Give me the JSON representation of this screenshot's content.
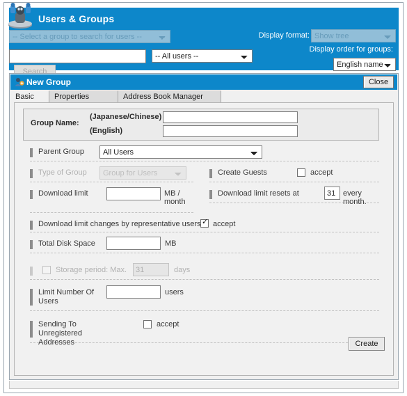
{
  "app": {
    "title": "Users & Groups",
    "icon": "users-group-icon",
    "accent_color": "#0d87ca"
  },
  "search_bar": {
    "group_select": {
      "value": "-- Select a group to search for users --",
      "disabled": true
    },
    "query_input": {
      "value": "",
      "placeholder": ""
    },
    "user_scope_select": {
      "value": "-- All users --",
      "disabled": false
    },
    "search_button": {
      "label": "Search",
      "disabled": true
    },
    "display_format": {
      "label": "Display format:",
      "value": "Show tree",
      "disabled": true
    },
    "display_order": {
      "label": "Display order for groups:",
      "value": "English names",
      "disabled": false
    }
  },
  "dialog": {
    "title": "New Group",
    "icon": "new-group-icon",
    "close_label": "Close",
    "tabs": [
      {
        "label": "Basic",
        "active": true
      },
      {
        "label": "Properties",
        "active": false
      },
      {
        "label": "Address Book Manager",
        "active": false
      }
    ],
    "group_name": {
      "label": "Group Name:",
      "japanese_chinese_label": "(Japanese/Chinese)",
      "japanese_chinese_value": "",
      "english_label": "(English)",
      "english_value": ""
    },
    "fields": {
      "parent_group": {
        "label": "Parent Group",
        "value": "All Users",
        "disabled": false
      },
      "type_of_group": {
        "label": "Type of Group",
        "value": "Group for Users",
        "disabled": true
      },
      "create_guests": {
        "label": "Create Guests",
        "checkbox_label": "accept",
        "checked": false,
        "disabled": false
      },
      "download_limit": {
        "label": "Download limit",
        "value": "",
        "unit": "MB / month",
        "disabled": false
      },
      "download_limit_resets": {
        "label": "Download limit resets at",
        "value": "31",
        "unit": "every month.",
        "disabled": false
      },
      "download_limit_changes": {
        "label": "Download limit changes by representative users",
        "checkbox_label": "accept",
        "checked": true,
        "disabled": false
      },
      "total_disk_space": {
        "label": "Total Disk Space",
        "value": "",
        "unit": "MB",
        "disabled": false
      },
      "storage_period": {
        "label": "Storage period: Max.",
        "value": "31",
        "unit": "days",
        "checked": false,
        "disabled": true
      },
      "limit_number_of_users": {
        "label": "Limit Number Of Users",
        "value": "",
        "unit": "users",
        "disabled": false
      },
      "sending_unregistered": {
        "label": "Sending To Unregistered Addresses",
        "checkbox_label": "accept",
        "checked": false,
        "disabled": false
      }
    },
    "create_button": {
      "label": "Create"
    }
  }
}
